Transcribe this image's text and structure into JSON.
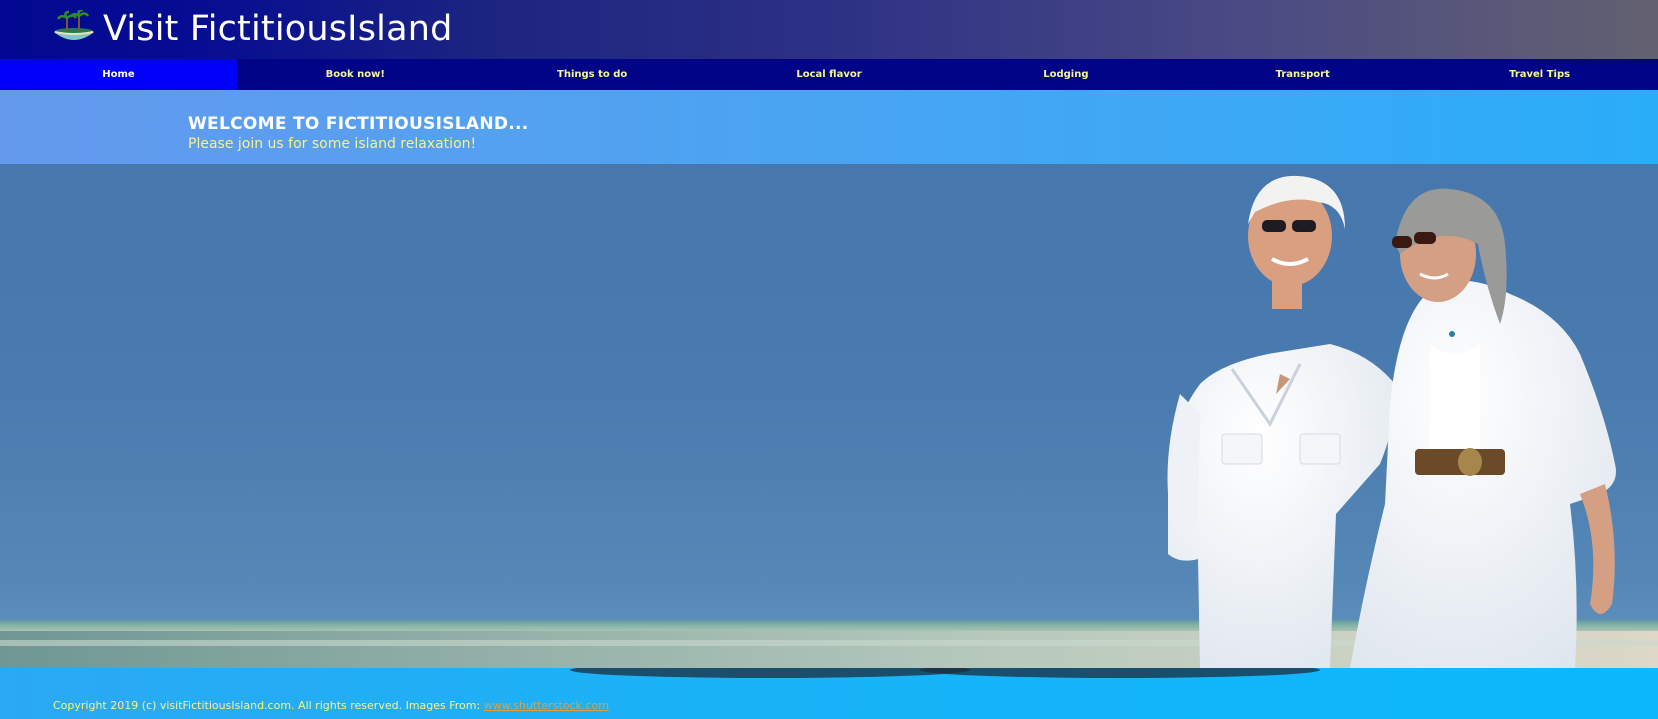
{
  "header": {
    "title": "Visit FictitiousIsland",
    "logo_icon": "island-palm-icon"
  },
  "nav": {
    "active_color": "#0000fb",
    "items": [
      {
        "label": "Home",
        "active": true
      },
      {
        "label": "Book now!"
      },
      {
        "label": "Things to do"
      },
      {
        "label": "Local flavor"
      },
      {
        "label": "Lodging"
      },
      {
        "label": "Transport"
      },
      {
        "label": "Travel Tips"
      }
    ]
  },
  "welcome": {
    "title": "WELCOME TO FICTITIOUSISLAND...",
    "subtitle": "Please join us for some island relaxation!"
  },
  "hero": {
    "image": "beach-couple-photo"
  },
  "footer": {
    "copyright": "Copyright 2019 (c) visitFictitiousIsland.com. All rights reserved. Images From: ",
    "link_text": "www.shutterstock.com"
  }
}
